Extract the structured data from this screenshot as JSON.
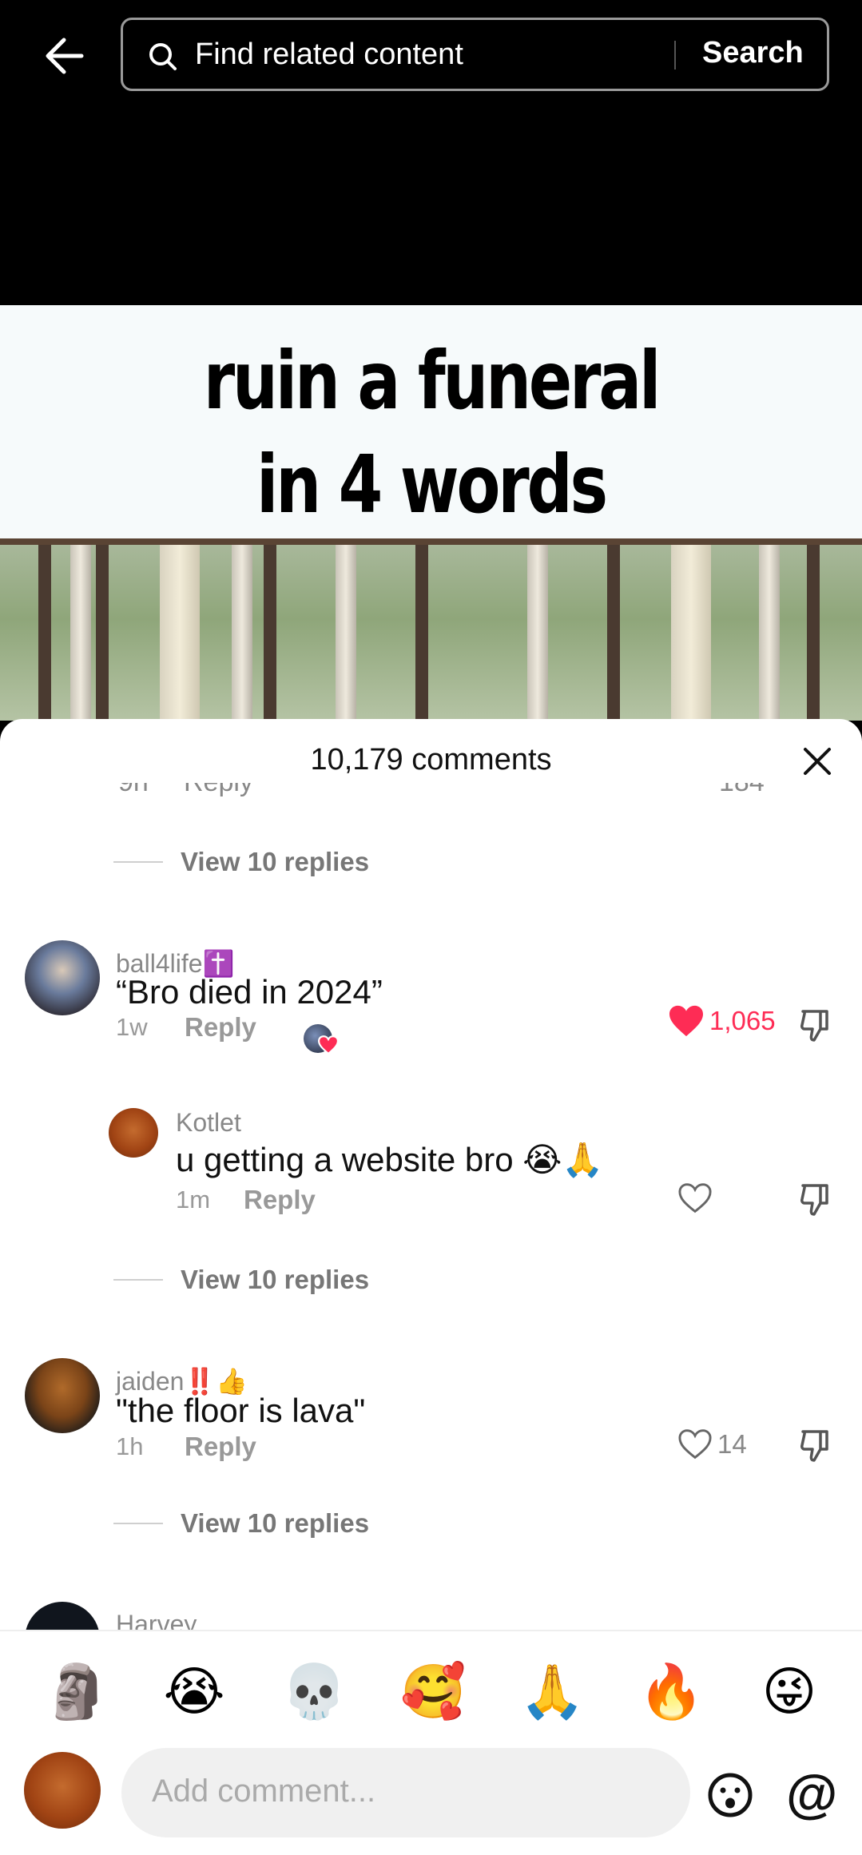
{
  "search": {
    "placeholder": "Find related content",
    "button_label": "Search"
  },
  "video": {
    "caption_line1": "ruin a funeral",
    "caption_line2": "in 4 words"
  },
  "sheet": {
    "title": "10,179 comments"
  },
  "partial_row": {
    "time": "9h",
    "reply_label": "Reply",
    "likes": "184"
  },
  "threads": [
    {
      "view_replies": "View 10 replies"
    }
  ],
  "comments": [
    {
      "username": "ball4life✝️",
      "text": "“Bro died in 2024”",
      "time": "1w",
      "reply_label": "Reply",
      "likes": "1,065",
      "liked": true
    },
    {
      "username": "jaiden‼️👍",
      "text": "\"the floor is lava\"",
      "time": "1h",
      "reply_label": "Reply",
      "likes": "14",
      "liked": false
    },
    {
      "username": "Harvey"
    }
  ],
  "reply": {
    "username": "Kotlet",
    "text": "u getting a website bro 😭🙏",
    "time": "1m",
    "reply_label": "Reply"
  },
  "view_replies_label": "View 10 replies",
  "emoji_bar": [
    "🗿",
    "😭",
    "💀",
    "🥰",
    "🙏",
    "🔥",
    "😜"
  ],
  "input": {
    "placeholder": "Add comment..."
  },
  "colors": {
    "like_red": "#fe2c55",
    "muted": "#999999"
  }
}
